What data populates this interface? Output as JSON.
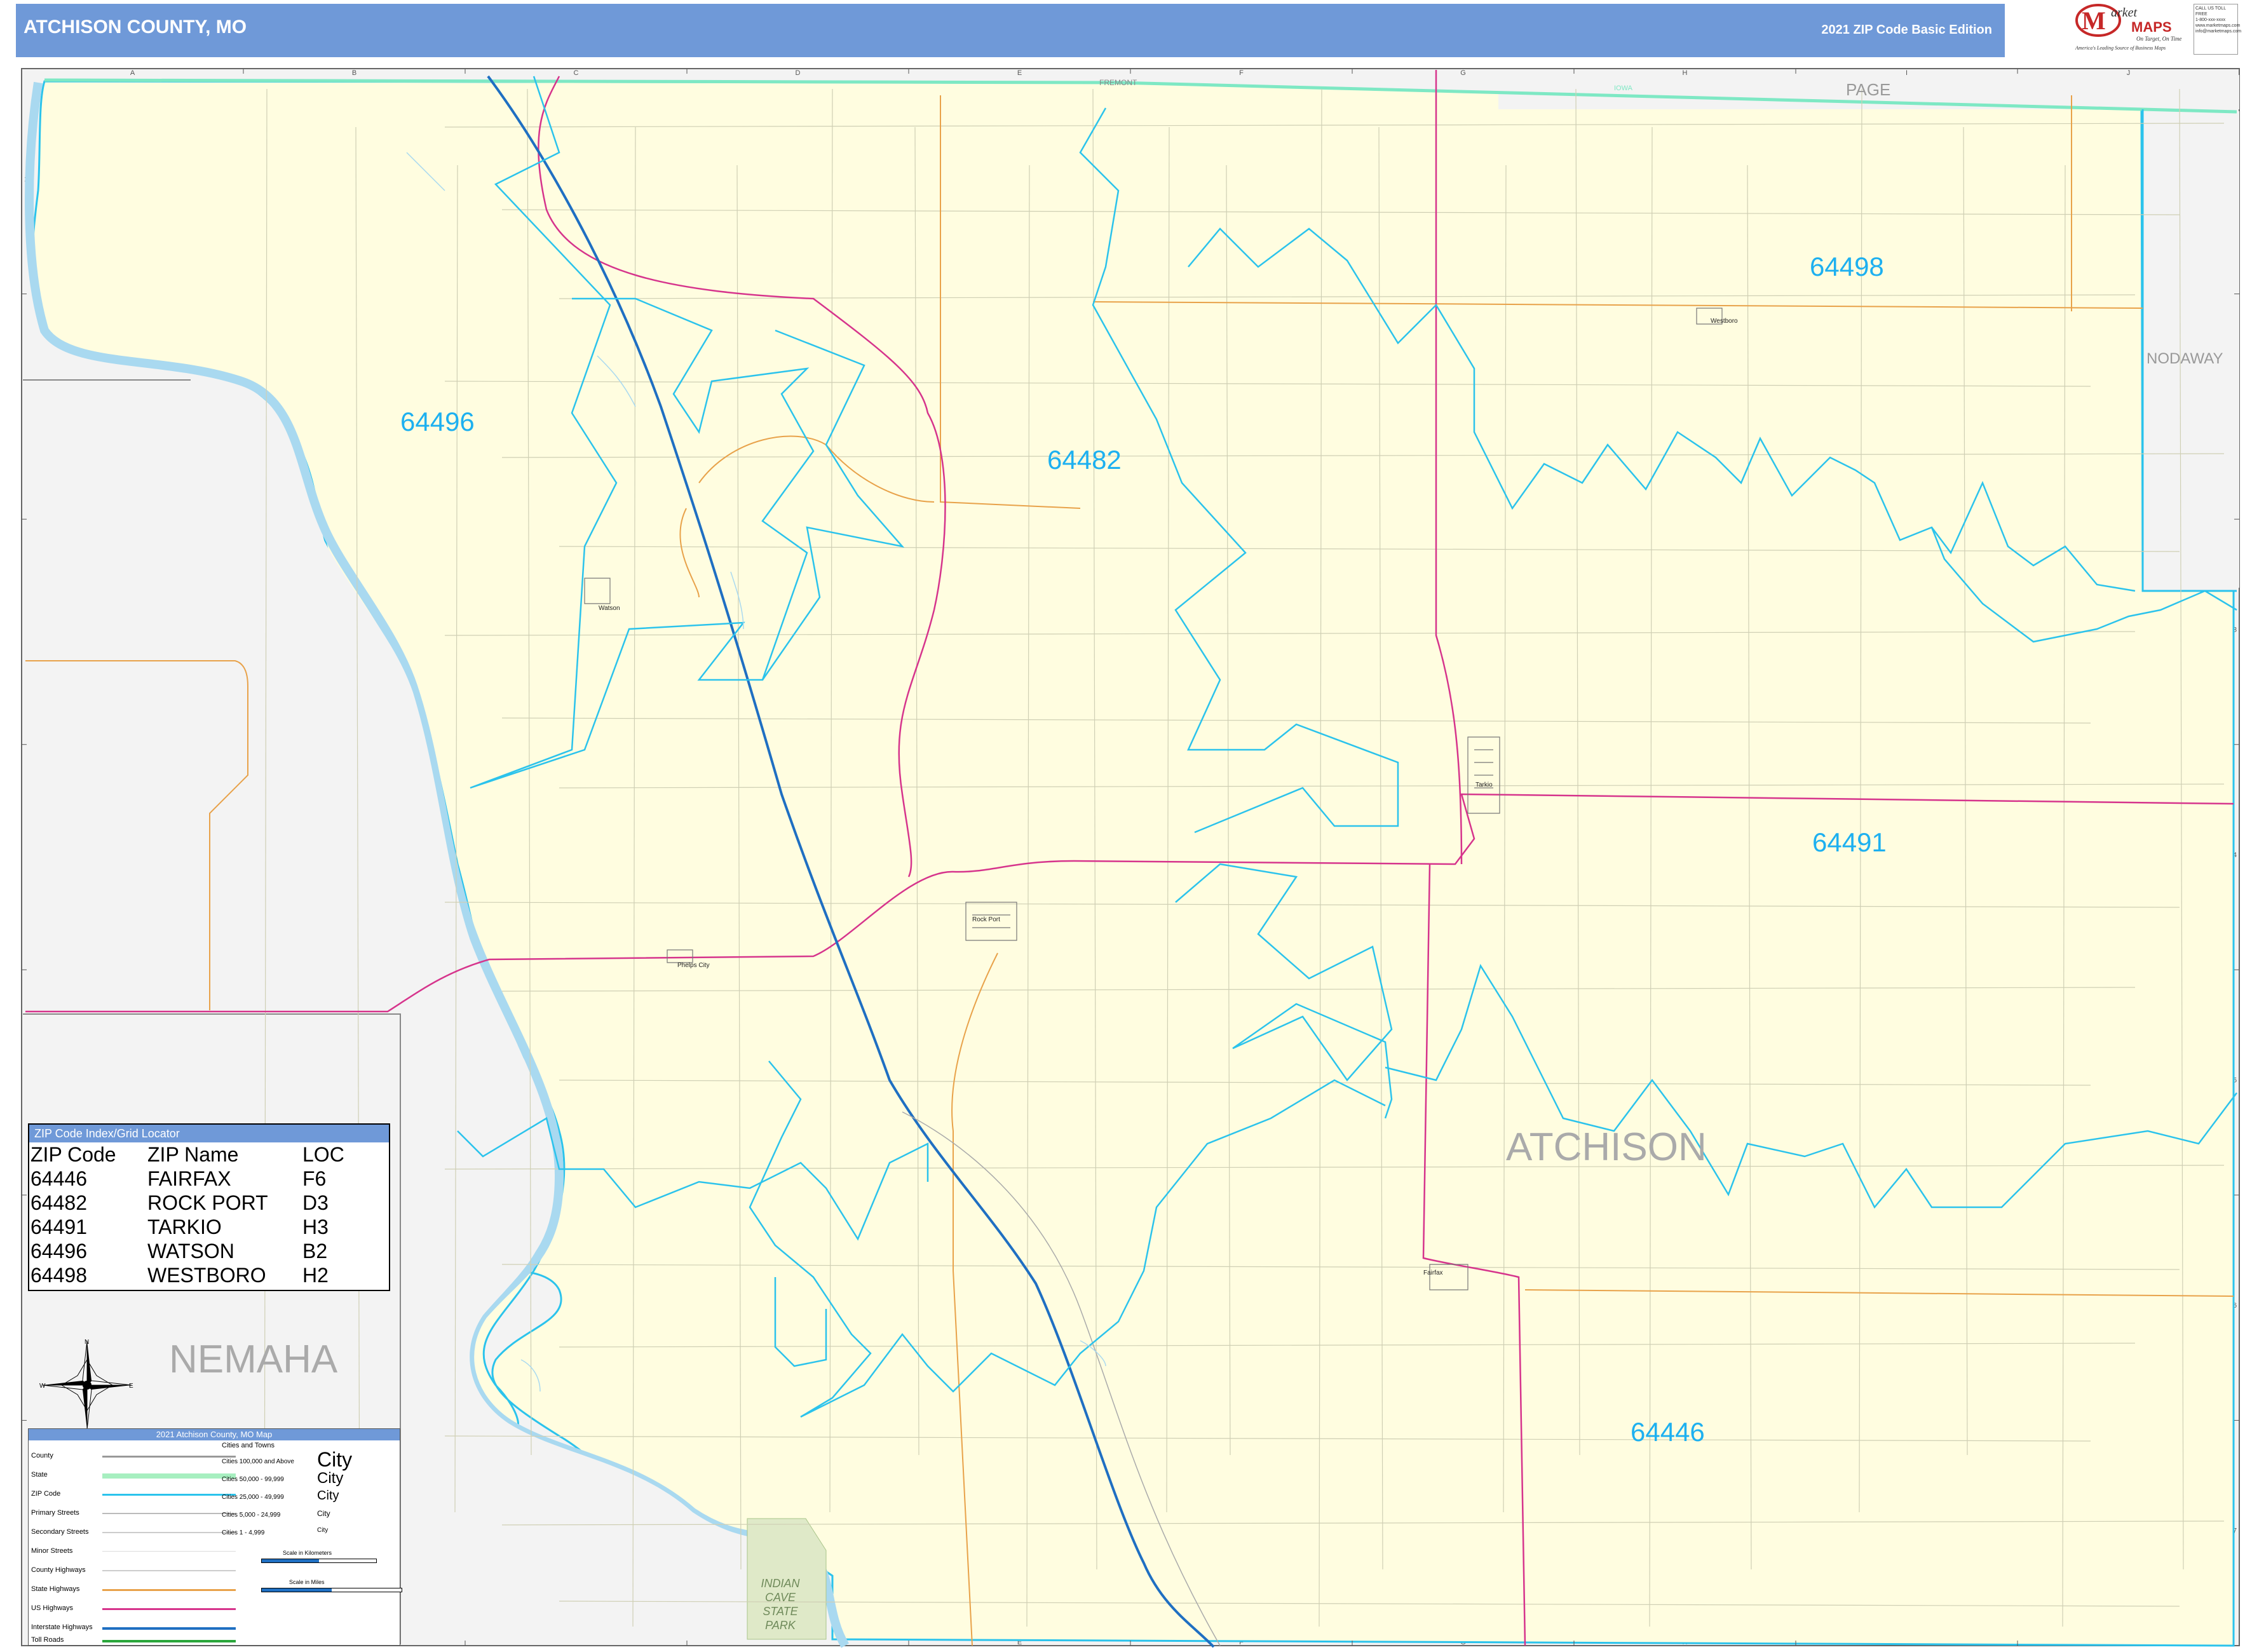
{
  "header": {
    "title": "ATCHISON COUNTY, MO",
    "edition": "2021 ZIP Code Basic Edition",
    "logo_text": "Market MAPS",
    "logo_tagline": "On Target, On Time - America's Leading Source of Business Maps",
    "bg_color": "#6f99d8"
  },
  "grid": {
    "columns": [
      "A",
      "B",
      "C",
      "D",
      "E",
      "F",
      "G",
      "H",
      "I",
      "J"
    ],
    "rows": [
      "1",
      "2",
      "3",
      "4",
      "5",
      "6",
      "7"
    ]
  },
  "neighbors": {
    "north_top": "FREMONT",
    "iowa": "IOWA",
    "page": "PAGE",
    "nodaway": "NODAWAY",
    "nemaha": "NEMAHA"
  },
  "county_label": "ATCHISON",
  "park_label": [
    "INDIAN",
    "CAVE",
    "STATE",
    "PARK"
  ],
  "zip_labels": [
    {
      "zip": "64496"
    },
    {
      "zip": "64482"
    },
    {
      "zip": "64498"
    },
    {
      "zip": "64491"
    },
    {
      "zip": "64446"
    }
  ],
  "cities": {
    "watson": "Watson",
    "westboro": "Westboro",
    "tarkio": "Tarkio",
    "rock_port": "Rock Port",
    "phelps_city": "Phelps City",
    "fairfax": "Fairfax"
  },
  "zip_index": {
    "title": "ZIP Code Index/Grid Locator",
    "headers": [
      "ZIP Code",
      "ZIP Name",
      "LOC"
    ],
    "rows": [
      [
        "64446",
        "FAIRFAX",
        "F6"
      ],
      [
        "64482",
        "ROCK PORT",
        "D3"
      ],
      [
        "64491",
        "TARKIO",
        "H3"
      ],
      [
        "64496",
        "WATSON",
        "B2"
      ],
      [
        "64498",
        "WESTBORO",
        "H2"
      ]
    ]
  },
  "legend": {
    "title": "2021 Atchison County, MO Map",
    "items": [
      "County",
      "State",
      "ZIP Code",
      "Primary Streets",
      "Secondary Streets",
      "Minor Streets",
      "County Highways",
      "State Highways",
      "US Highways",
      "Interstate Highways",
      "Toll Roads"
    ],
    "cities_title": "Cities and Towns",
    "city_classes": [
      "Cities 100,000 and Above",
      "Cities 50,000 - 99,999",
      "Cities 25,000 - 49,999",
      "Cities 5,000 - 24,999",
      "Cities 1 - 4,999"
    ],
    "city_samples": [
      "City",
      "City",
      "City",
      "City",
      "City"
    ],
    "scale_km": "Scale in Kilometers",
    "scale_mi": "Scale in Miles"
  },
  "compass": {
    "n": "N",
    "s": "S",
    "e": "E",
    "w": "W"
  },
  "colors": {
    "zip_boundary": "#2bc3ec",
    "county_fill": "#fffde0",
    "state_line": "#7ee8c4",
    "us_highway": "#d6348c",
    "interstate": "#1f6fc2",
    "state_highway": "#e8a24a",
    "zip_label": "#1db0f0",
    "water": "#a9d9f0"
  }
}
